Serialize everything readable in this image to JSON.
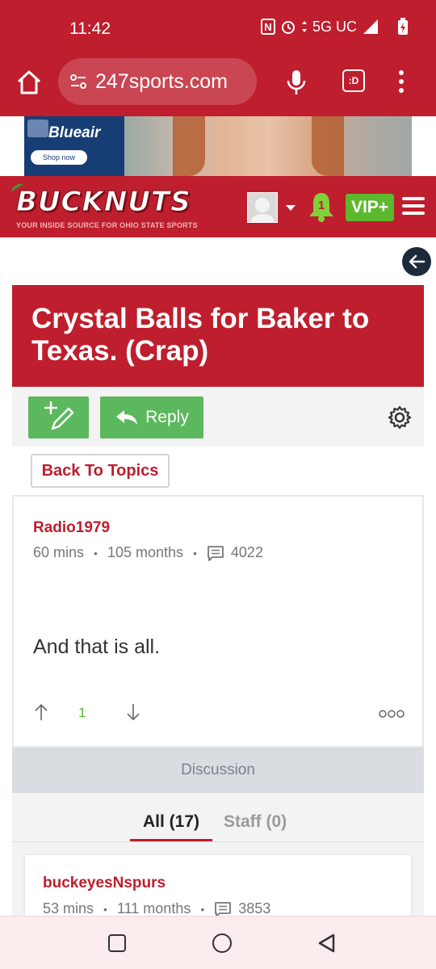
{
  "status_bar": {
    "time": "11:42",
    "network": "5G UC",
    "icons": [
      "nfc-icon",
      "alarm-icon",
      "data-arrows-icon",
      "signal-icon",
      "battery-charging-icon"
    ]
  },
  "browser": {
    "url": "247sports.com",
    "tab_label": ":D",
    "icons": [
      "home-icon",
      "site-settings-icon",
      "mic-icon",
      "tabs-icon",
      "more-vert-icon"
    ]
  },
  "ad": {
    "brand": "Blueair",
    "cta": "Shop now"
  },
  "site_header": {
    "logo_title": "BUCKNUTS",
    "logo_tagline": "YOUR INSIDE SOURCE FOR OHIO STATE SPORTS",
    "notification_count": "1",
    "vip_label": "VIP+",
    "colors": {
      "brand_red": "#be1e2d",
      "vip_green": "#5cb82d"
    }
  },
  "thread": {
    "title": "Crystal Balls for Baker to Texas. (Crap)",
    "reply_label": "Reply",
    "back_to_topics": "Back To Topics"
  },
  "post": {
    "author": "Radio1979",
    "age": "60 mins",
    "member_for": "105 months",
    "post_count": "4022",
    "body": "And that is all.",
    "votes": "1"
  },
  "discussion": {
    "header": "Discussion",
    "tab_all": "All (17)",
    "tab_staff": "Staff (0)"
  },
  "reply": {
    "author": "buckeyesNspurs",
    "age": "53 mins",
    "member_for": "111 months",
    "post_count": "3853"
  }
}
